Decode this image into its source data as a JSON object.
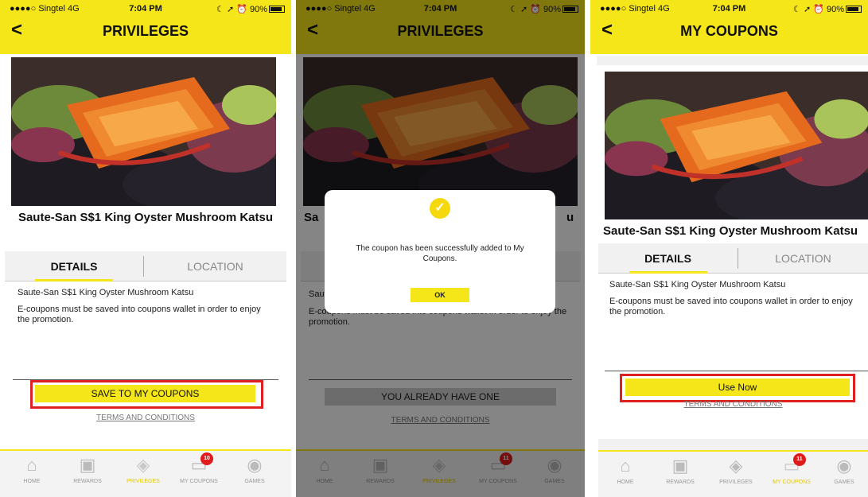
{
  "status": {
    "carrier": "●●●●○ Singtel  4G",
    "time": "7:04 PM",
    "right": "☾ ➚ ⏰ 90%"
  },
  "nav": {
    "back": "<"
  },
  "s1": {
    "title": "PRIVILEGES",
    "product": "Saute-San S$1 King Oyster Mushroom Katsu",
    "tab_details": "DETAILS",
    "tab_location": "LOCATION",
    "desc_line1": "Saute-San S$1 King Oyster Mushroom Katsu",
    "desc_line2": "E-coupons must be saved into coupons wallet in order to enjoy the promotion.",
    "button": "SAVE TO MY COUPONS",
    "terms": "TERMS AND CONDITIONS",
    "badge": "10"
  },
  "s2": {
    "title": "PRIVILEGES",
    "product_left": "Sa",
    "product_right": "u",
    "desc_line1": "Saut",
    "desc_line2": "E-coupons must be saved into coupons wallet in order to enjoy the promotion.",
    "button": "YOU ALREADY HAVE ONE",
    "terms": "TERMS AND CONDITIONS",
    "dialog_message": "The coupon has been successfully added to My Coupons.",
    "dialog_ok": "OK",
    "badge": "11"
  },
  "s3": {
    "title": "MY COUPONS",
    "product": "Saute-San S$1 King Oyster Mushroom Katsu",
    "tab_details": "DETAILS",
    "tab_location": "LOCATION",
    "desc_line1": "Saute-San S$1 King Oyster Mushroom Katsu",
    "desc_line2": "E-coupons must be saved into coupons wallet in order to enjoy the promotion.",
    "button": "Use Now",
    "terms": "TERMS AND CONDITIONS",
    "badge": "11"
  },
  "tabbar": {
    "home": "HOME",
    "rewards": "REWARDS",
    "privileges": "PRIVILEGES",
    "mycoupons": "MY COUPONS",
    "games": "GAMES"
  },
  "icons": {
    "home": "home-icon",
    "rewards": "gift-icon",
    "privileges": "tag-icon",
    "mycoupons": "coupon-icon",
    "games": "gamepad-icon"
  },
  "colors": {
    "accent": "#f5e619",
    "highlight_box": "#e02020",
    "badge": "#e01b1b"
  }
}
